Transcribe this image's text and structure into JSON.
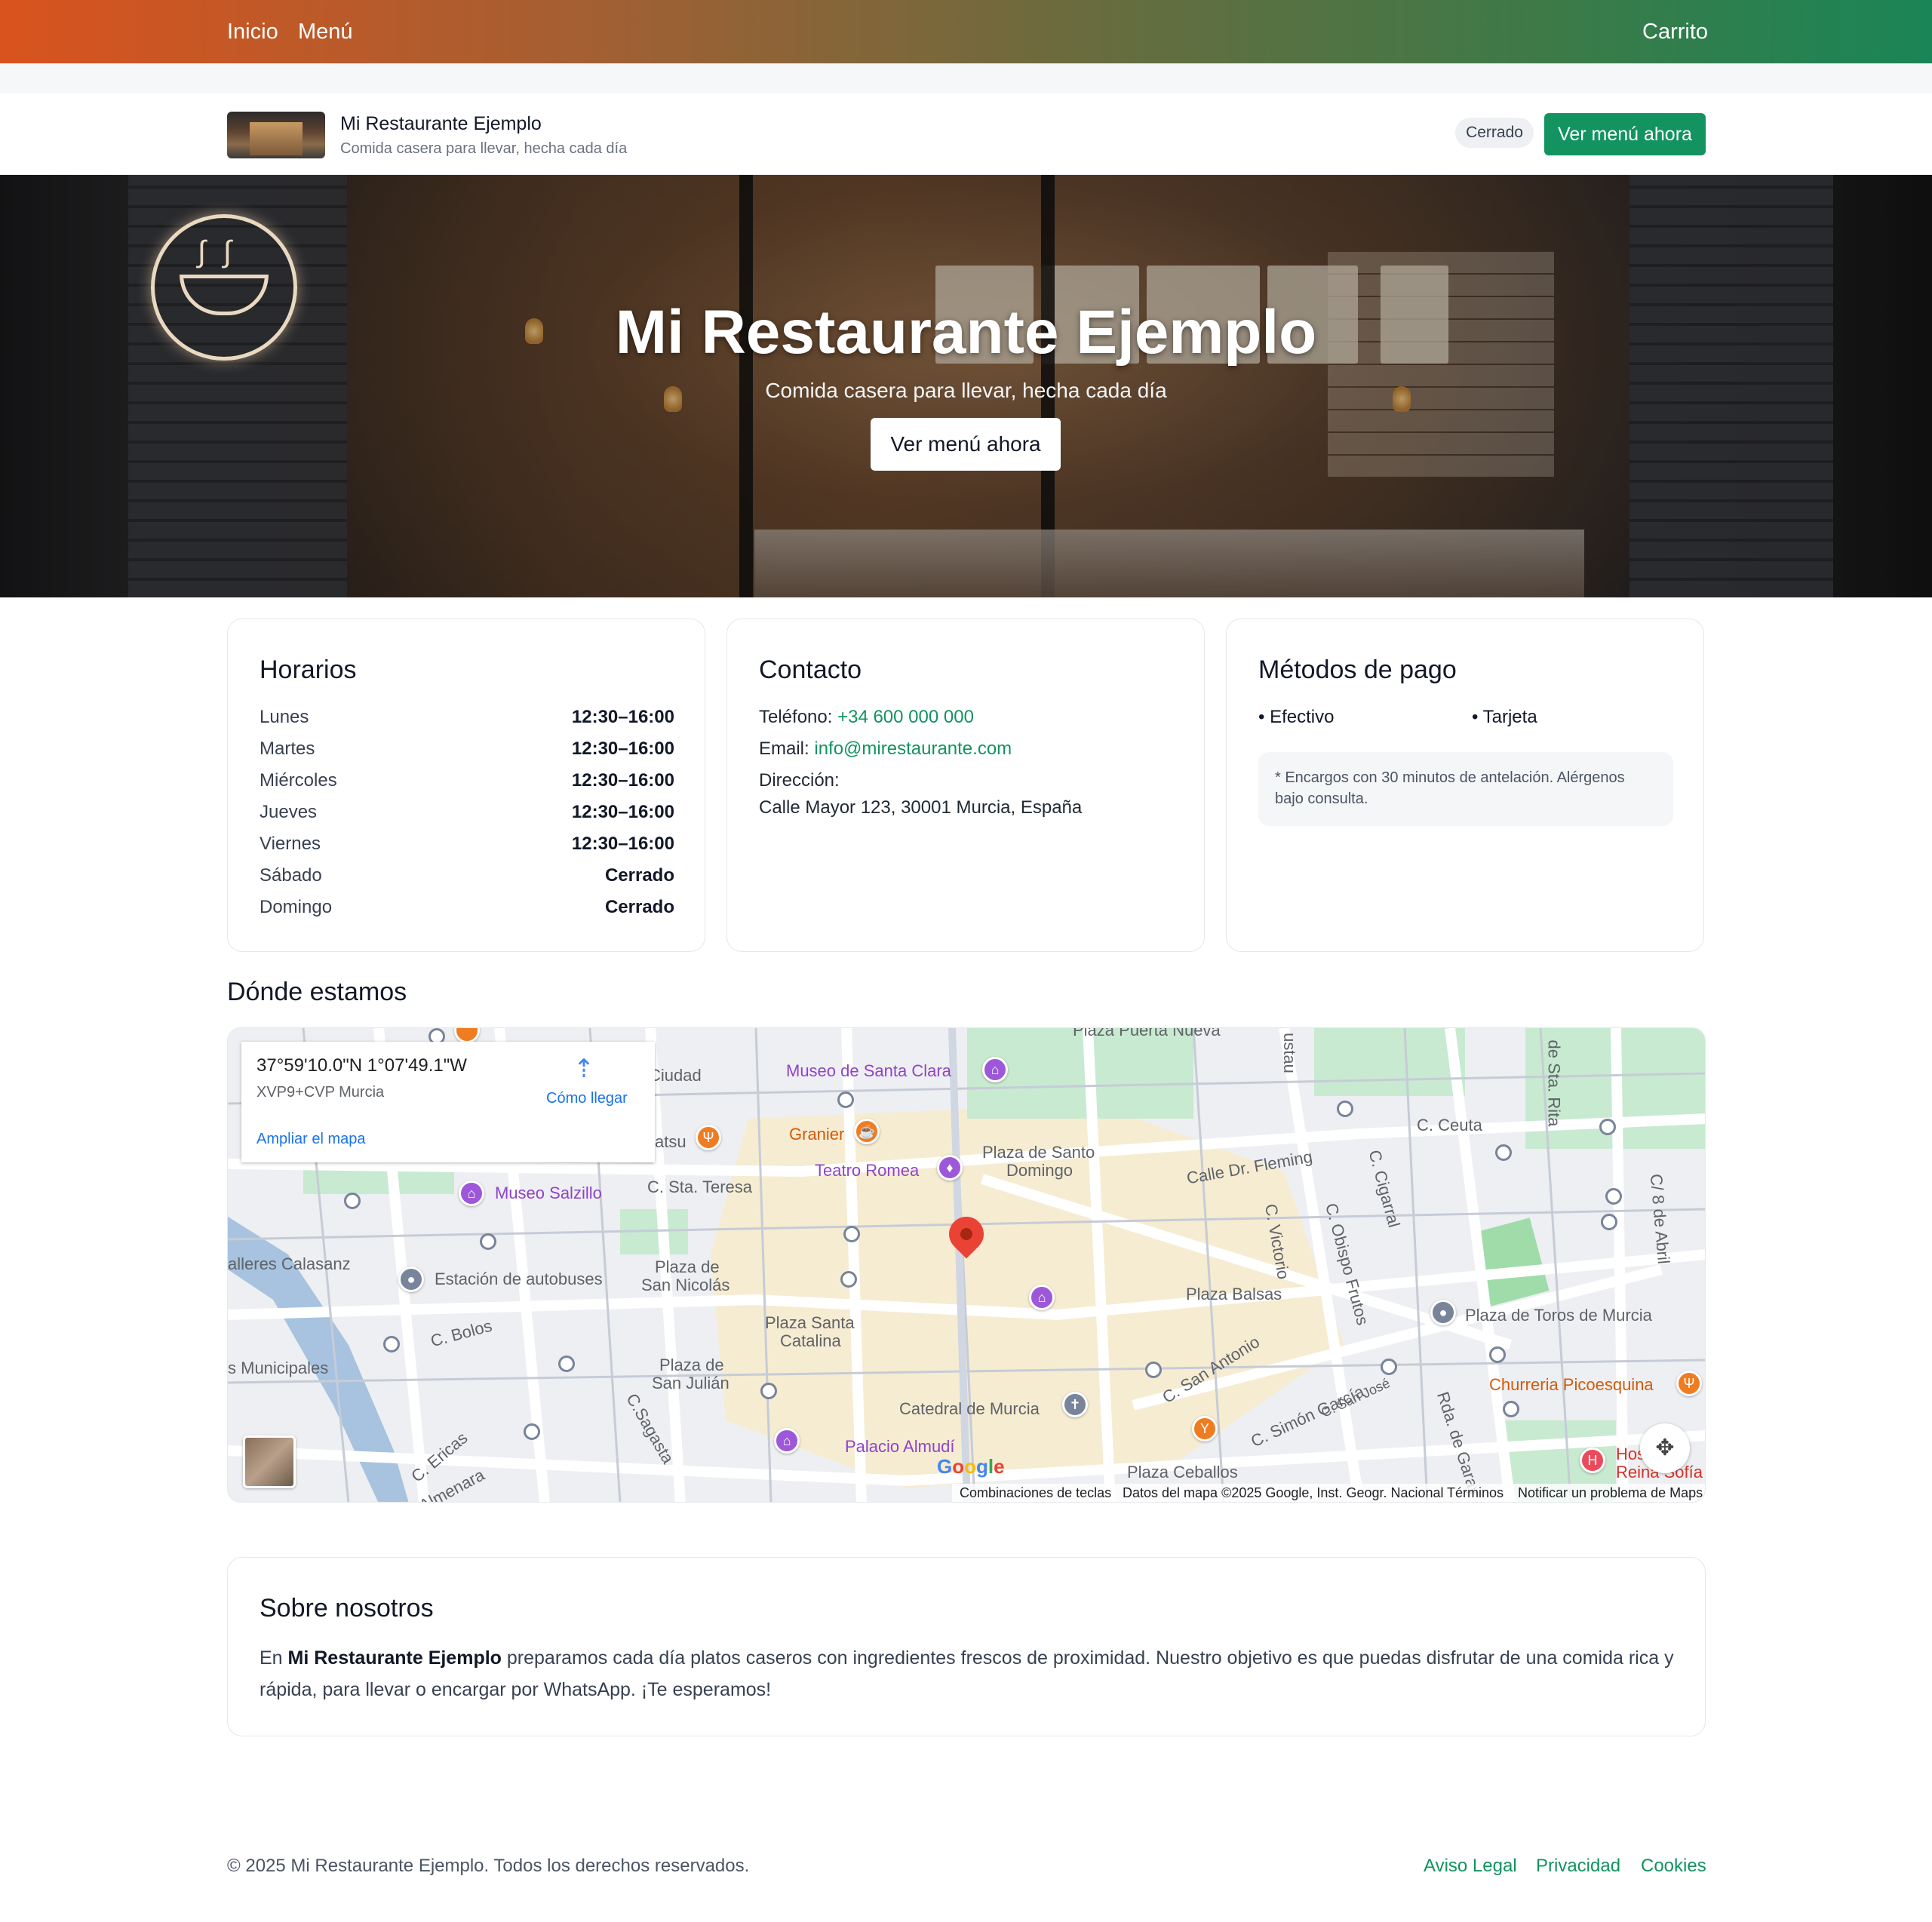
{
  "nav": {
    "home": "Inicio",
    "menu": "Menú",
    "cart": "Carrito"
  },
  "brand": {
    "name": "Mi Restaurante Ejemplo",
    "tagline": "Comida casera para llevar, hecha cada día",
    "status": "Cerrado",
    "cta": "Ver menú ahora"
  },
  "hero": {
    "title": "Mi Restaurante Ejemplo",
    "subtitle": "Comida casera para llevar, hecha cada día",
    "cta": "Ver menú ahora"
  },
  "hours": {
    "title": "Horarios",
    "rows": [
      {
        "day": "Lunes",
        "time": "12:30–16:00"
      },
      {
        "day": "Martes",
        "time": "12:30–16:00"
      },
      {
        "day": "Miércoles",
        "time": "12:30–16:00"
      },
      {
        "day": "Jueves",
        "time": "12:30–16:00"
      },
      {
        "day": "Viernes",
        "time": "12:30–16:00"
      },
      {
        "day": "Sábado",
        "time": "Cerrado"
      },
      {
        "day": "Domingo",
        "time": "Cerrado"
      }
    ]
  },
  "contact": {
    "title": "Contacto",
    "phone_label": "Teléfono:",
    "phone": "+34 600 000 000",
    "email_label": "Email:",
    "email": "info@mirestaurante.com",
    "address_label": "Dirección:",
    "address": "Calle Mayor 123, 30001 Murcia, España"
  },
  "payment": {
    "title": "Métodos de pago",
    "methods": [
      "• Efectivo",
      "• Tarjeta"
    ],
    "note": "* Encargos con 30 minutos de antelación. Alérgenos bajo consulta."
  },
  "map": {
    "section_title": "Dónde estamos",
    "coords": "37°59'10.0\"N 1°07'49.1\"W",
    "plus_code": "XVP9+CVP Murcia",
    "directions": "Cómo llegar",
    "enlarge": "Ampliar el mapa",
    "labels": {
      "plaza_puerta_nueva": "Plaza Puerta Nueva",
      "ciudad": "Ciudad",
      "museo_santa_clara": "Museo de Santa Clara",
      "atsu": "atsu",
      "granier": "Granier",
      "teatro_romea": "Teatro Romea",
      "plaza_santo_domingo_1": "Plaza de Santo",
      "plaza_santo_domingo_2": "Domingo",
      "c_ceuta": "C. Ceuta",
      "calle_fleming": "Calle Dr. Fleming",
      "museo_salzillo": "Museo Salzillo",
      "c_sta_teresa": "C. Sta. Teresa",
      "talleres": "alleres Calasanz",
      "estacion": "Estación de autobuses",
      "plaza_san_nicolas_1": "Plaza de",
      "plaza_san_nicolas_2": "San Nicolás",
      "c_victorio": "C. Victorio",
      "c_cigarral": "C. Cigarral",
      "c_obispo": "C. Obispo Frutos",
      "c_abril": "C/ 8 de Abril",
      "de_sta_rita": "de Sta. Rita",
      "ustau": "ustau",
      "plaza_balsas": "Plaza Balsas",
      "plaza_toros": "Plaza de Toros de Murcia",
      "c_bolos": "C. Bolos",
      "plaza_santa_catalina_1": "Plaza Santa",
      "plaza_santa_catalina_2": "Catalina",
      "municipales": "s Municipales",
      "plaza_san_julian_1": "Plaza de",
      "plaza_san_julian_2": "San Julián",
      "c_san_antonio": "C. San Antonio",
      "catedral": "Catedral de Murcia",
      "c_simon_garcia": "C. Simón García",
      "c_san_jose": "C. San José",
      "churreria": "Churreria Picoesquina",
      "c_sagasta": "C.Sagasta",
      "palacio_almudi": "Palacio Almudí",
      "rda_garay": "Rda. de Garay",
      "c_ericas": "C. Ericas",
      "almenara": "Almenara",
      "plaza_ceballos": "Plaza Ceballos",
      "hospital_1": "Hos",
      "hospital_2": "Reina Sofía"
    },
    "google": "Google",
    "attribution": {
      "shortcuts": "Combinaciones de teclas",
      "data": "Datos del mapa ©2025 Google, Inst. Geogr. Nacional",
      "terms": "Términos",
      "report": "Notificar un problema de Maps"
    }
  },
  "about": {
    "title": "Sobre nosotros",
    "intro": "En ",
    "name": "Mi Restaurante Ejemplo",
    "body": " preparamos cada día platos caseros con ingredientes frescos de proximidad. Nuestro objetivo es que puedas disfrutar de una comida rica y rápida, para llevar o encargar por WhatsApp. ¡Te esperamos!"
  },
  "footer": {
    "copyright": "© 2025 Mi Restaurante Ejemplo. Todos los derechos reservados.",
    "links": [
      "Aviso Legal",
      "Privacidad",
      "Cookies"
    ]
  },
  "colors": {
    "accent": "#12935f",
    "nav_gradient_start": "#d9531e",
    "nav_gradient_end": "#1a8556"
  }
}
